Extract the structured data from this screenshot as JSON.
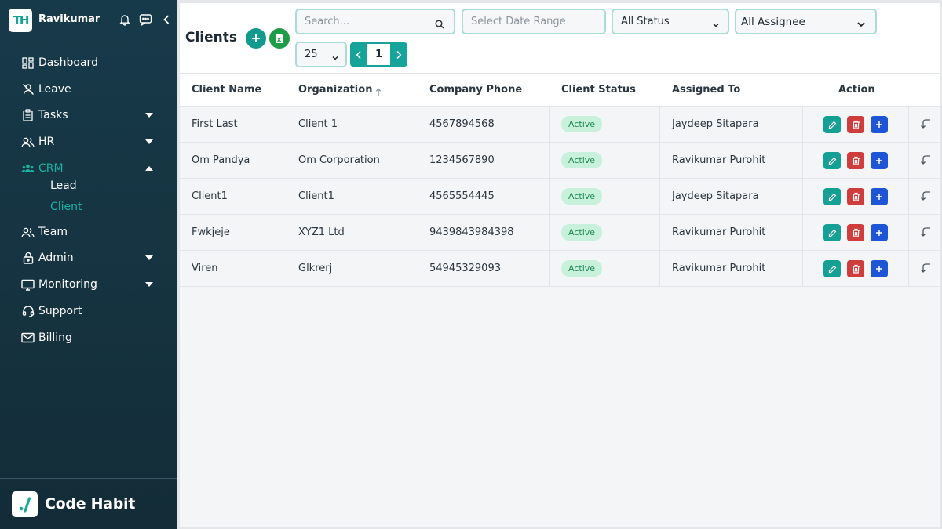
{
  "header": {
    "logo_text": "TH",
    "user_name": "Ravikumar"
  },
  "sidebar": {
    "items": [
      {
        "label": "Dashboard",
        "icon": "dashboard-icon"
      },
      {
        "label": "Leave",
        "icon": "user-off-icon"
      },
      {
        "label": "Tasks",
        "icon": "clipboard-icon"
      },
      {
        "label": "HR",
        "icon": "users-icon"
      },
      {
        "label": "CRM",
        "icon": "people-group-icon"
      },
      {
        "label": "Team",
        "icon": "team-icon"
      },
      {
        "label": "Admin",
        "icon": "lock-icon"
      },
      {
        "label": "Monitoring",
        "icon": "monitor-icon"
      },
      {
        "label": "Support",
        "icon": "headset-icon"
      },
      {
        "label": "Billing",
        "icon": "mail-icon"
      }
    ],
    "crm_sub": [
      {
        "label": "Lead"
      },
      {
        "label": "Client"
      }
    ],
    "footer_brand": "Code Habit"
  },
  "toolbar": {
    "title": "Clients",
    "search_placeholder": "Search...",
    "date_placeholder": "Select Date Range",
    "status_filter": "All Status",
    "assignee_filter": "All Assignee",
    "page_size": "25",
    "page_number": "1"
  },
  "colors": {
    "accent": "#15a39a",
    "sidebar_bg": "#173a4a",
    "active_text": "#1ab3a3",
    "badge_bg": "#c8f1db"
  },
  "table": {
    "columns": [
      "Client Name",
      "Organization",
      "Company Phone",
      "Client Status",
      "Assigned To",
      "Action"
    ],
    "rows": [
      [
        "First Last",
        "Client 1",
        "4567894568",
        "Active",
        "Jaydeep Sitapara"
      ],
      [
        "Om Pandya",
        "Om Corporation",
        "1234567890",
        "Active",
        "Ravikumar Purohit"
      ],
      [
        "Client1",
        "Client1",
        "4565554445",
        "Active",
        "Jaydeep Sitapara"
      ],
      [
        "Fwkjeje",
        "XYZ1 Ltd",
        "9439843984398",
        "Active",
        "Ravikumar Purohit"
      ],
      [
        "Viren",
        "Glkrerj",
        "54945329093",
        "Active",
        "Ravikumar Purohit"
      ]
    ]
  }
}
